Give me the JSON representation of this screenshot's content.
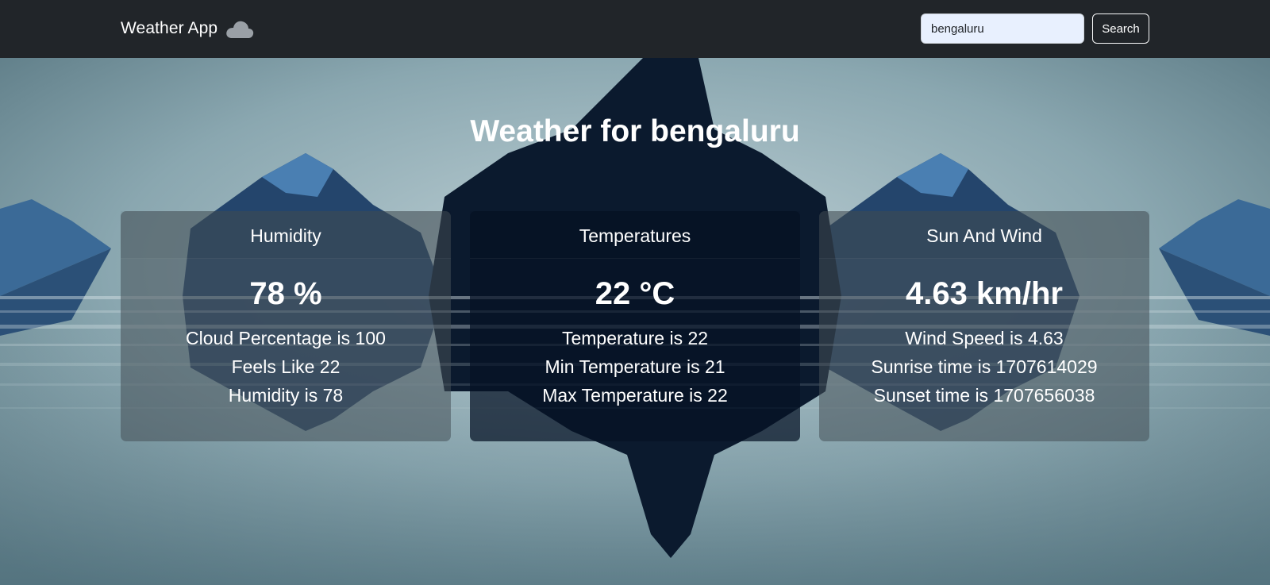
{
  "navbar": {
    "brand": "Weather App",
    "brand_icon": "cloud-icon",
    "search_value": "bengaluru",
    "search_button": "Search"
  },
  "title": "Weather for bengaluru",
  "cards": [
    {
      "header": "Humidity",
      "value": "78 %",
      "lines": [
        "Cloud Percentage is 100",
        "Feels Like 22",
        "Humidity is 78"
      ]
    },
    {
      "header": "Temperatures",
      "value": "22 °C",
      "lines": [
        "Temperature is 22",
        "Min Temperature is 21",
        "Max Temperature is 22"
      ]
    },
    {
      "header": "Sun And Wind",
      "value": "4.63 km/hr",
      "lines": [
        "Wind Speed is 4.63",
        "Sunrise time is 1707614029",
        "Sunset time is 1707656038"
      ]
    }
  ],
  "colors": {
    "navbar": "#212529",
    "sky": "#9fb8bf",
    "mountain_dark": "#0b1a2e",
    "mountain_blue": "#3c6a99"
  }
}
